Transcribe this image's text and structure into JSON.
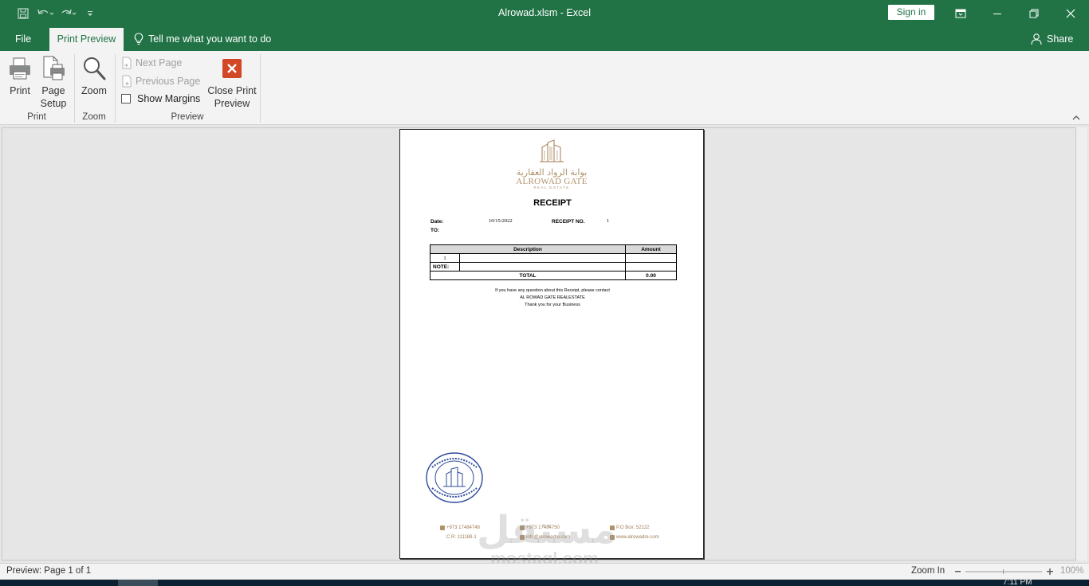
{
  "titlebar": {
    "title": "Alrowad.xlsm  -  Excel",
    "sign_in": "Sign in"
  },
  "tabs": {
    "file": "File",
    "print_preview": "Print Preview",
    "tell_me": "Tell me what you want to do",
    "share": "Share"
  },
  "ribbon": {
    "print_label": "Print",
    "page_setup_line1": "Page",
    "page_setup_line2": "Setup",
    "zoom_label": "Zoom",
    "next_page": "Next Page",
    "previous_page": "Previous Page",
    "show_margins": "Show Margins",
    "close_line1": "Close Print",
    "close_line2": "Preview",
    "group_print": "Print",
    "group_zoom": "Zoom",
    "group_preview": "Preview"
  },
  "receipt": {
    "logo_arabic": "بوابة الرواد العقارية",
    "logo_english": "ALROWAD GATE",
    "logo_sub": "REAL ESTATE",
    "title": "RECEIPT",
    "date_label": "Date:",
    "date_value": "10/15/2022",
    "receipt_no_label": "RECEIPT NO.",
    "receipt_no_value": "1",
    "to_label": "TO:",
    "col_description": "Description",
    "col_amount": "Amount",
    "row1_index": "1",
    "note_label": "NOTE:",
    "total_label": "TOTAL",
    "total_value": "0.00",
    "footer_line1": "If you have any question about this Receipt, please contact",
    "footer_line2": "AL ROWAD GATE REALESTATE",
    "footer_line3": "Thank you for your Business",
    "phone1": "+973 17484748",
    "phone2": "+973 17484750",
    "po_box": "P.O Box: 52122",
    "cr": "C.R: 111188-1",
    "email": "info@alrowadre.com",
    "website": "www.alrowadre.com"
  },
  "watermark": {
    "arabic": "مستقل",
    "latin": "mostaql.com"
  },
  "statusbar": {
    "preview": "Preview: Page 1 of 1",
    "zoom_in": "Zoom In",
    "zoom_pct": "100%"
  },
  "taskbar": {
    "clock": "7:11 PM"
  },
  "colors": {
    "excel_green": "#217346",
    "logo_gold": "#b0926a",
    "close_red": "#d24726"
  }
}
